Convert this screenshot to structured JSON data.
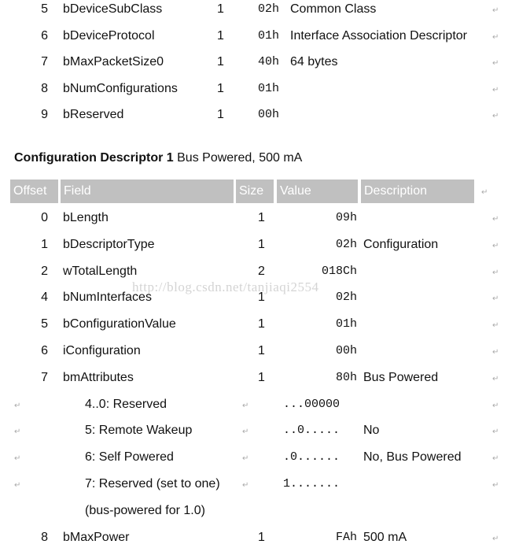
{
  "return_mark": "↵",
  "colors": {
    "header_bg": "#c0c0c0",
    "header_text": "#ffffff"
  },
  "device_rows": [
    {
      "offset": "5",
      "field": "bDeviceSubClass",
      "size": "1",
      "value": "02h",
      "description": "Common Class"
    },
    {
      "offset": "6",
      "field": "bDeviceProtocol",
      "size": "1",
      "value": "01h",
      "description": "Interface Association Descriptor"
    },
    {
      "offset": "7",
      "field": "bMaxPacketSize0",
      "size": "1",
      "value": "40h",
      "description": "64 bytes"
    },
    {
      "offset": "8",
      "field": "bNumConfigurations",
      "size": "1",
      "value": "01h",
      "description": ""
    },
    {
      "offset": "9",
      "field": "bReserved",
      "size": "1",
      "value": "00h",
      "description": ""
    }
  ],
  "config_heading": {
    "bold": "Configuration Descriptor 1",
    "rest": " Bus Powered, 500 mA"
  },
  "config_table": {
    "headers": [
      "Offset",
      "Field",
      "Size",
      "Value",
      "Description"
    ],
    "rows": [
      {
        "offset": "0",
        "field": "bLength",
        "size": "1",
        "value": "09h",
        "description": ""
      },
      {
        "offset": "1",
        "field": "bDescriptorType",
        "size": "1",
        "value": "02h",
        "description": "Configuration"
      },
      {
        "offset": "2",
        "field": "wTotalLength",
        "size": "2",
        "value": "018Ch",
        "description": ""
      },
      {
        "offset": "4",
        "field": "bNumInterfaces",
        "size": "1",
        "value": "02h",
        "description": ""
      },
      {
        "offset": "5",
        "field": "bConfigurationValue",
        "size": "1",
        "value": "01h",
        "description": ""
      },
      {
        "offset": "6",
        "field": "iConfiguration",
        "size": "1",
        "value": "00h",
        "description": ""
      },
      {
        "offset": "7",
        "field": "bmAttributes",
        "size": "1",
        "value": "80h",
        "description": "Bus Powered"
      },
      {
        "sub": true,
        "field": "4..0: Reserved",
        "value": "...00000",
        "description": ""
      },
      {
        "sub": true,
        "field": "5: Remote Wakeup",
        "value": "..0.....",
        "description": "No"
      },
      {
        "sub": true,
        "field": "6: Self Powered",
        "value": ".0......",
        "description": "No, Bus Powered"
      },
      {
        "sub": true,
        "field": "7: Reserved (set to one)",
        "value": "1.......",
        "description": ""
      },
      {
        "cont": true,
        "field": "(bus-powered for 1.0)"
      },
      {
        "offset": "8",
        "field": "bMaxPower",
        "size": "1",
        "value": "FAh",
        "description": "500 mA"
      }
    ]
  },
  "watermark": "http://blog.csdn.net/tanjiaqi2554"
}
